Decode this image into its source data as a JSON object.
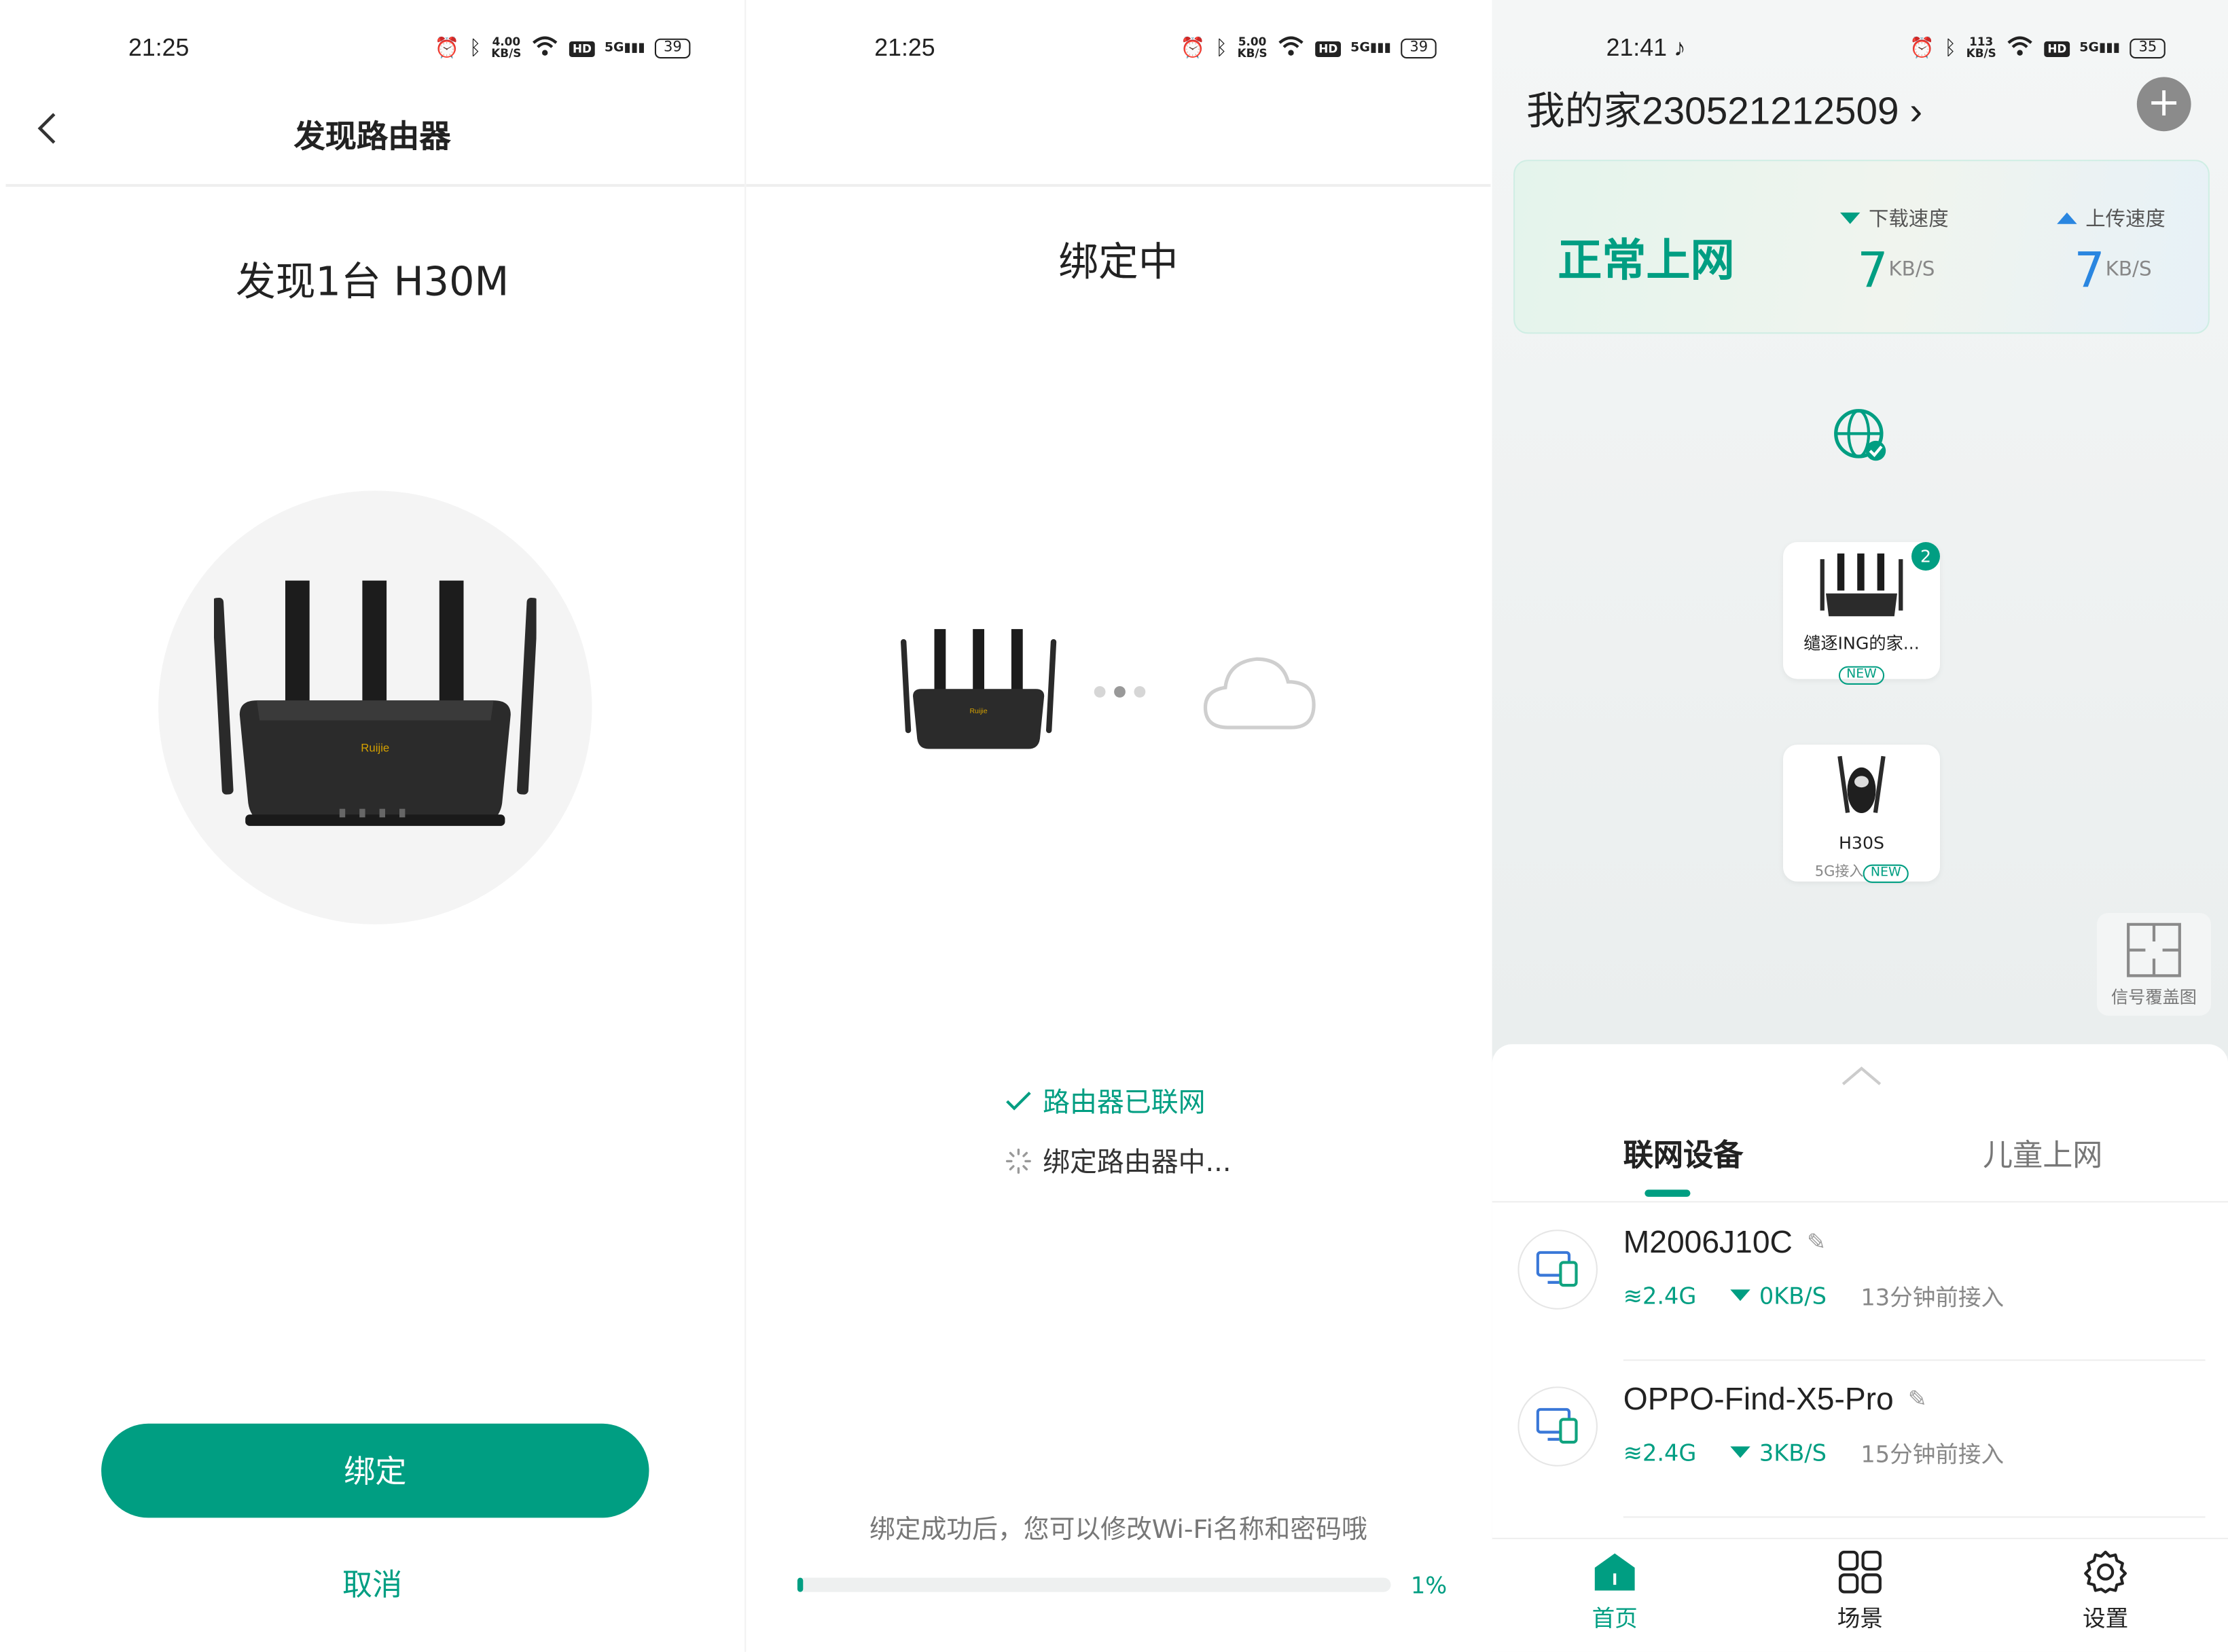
{
  "colors": {
    "brand": "#009e82",
    "upload": "#2a86e0"
  },
  "panel1": {
    "status": {
      "time": "21:25",
      "speed_num": "4.00",
      "speed_unit": "KB/S",
      "hd": "HD",
      "net": "5G",
      "battery": "39"
    },
    "title": "发现路由器",
    "found_text": "发现1台 H30M",
    "router_brand": "Ruijie",
    "bind_label": "绑定",
    "cancel_label": "取消"
  },
  "panel2": {
    "status": {
      "time": "21:25",
      "speed_num": "5.00",
      "speed_unit": "KB/S",
      "hd": "HD",
      "net": "5G",
      "battery": "39"
    },
    "title": "绑定中",
    "router_brand": "Ruijie",
    "step_connected": "路由器已联网",
    "step_binding": "绑定路由器中...",
    "hint": "绑定成功后，您可以修改Wi-Fi名称和密码哦",
    "progress_label": "1%",
    "progress_value": 0.01
  },
  "panel3": {
    "status": {
      "time": "21:41",
      "speed_num": "113",
      "speed_unit": "KB/S",
      "hd": "HD",
      "net": "5G",
      "battery": "35"
    },
    "home_title": "我的家230521212509",
    "net_status": "正常上网",
    "download": {
      "label": "下载速度",
      "value": "7",
      "unit": "KB/S"
    },
    "upload": {
      "label": "上传速度",
      "value": "7",
      "unit": "KB/S"
    },
    "main_node": {
      "name": "缱逐ING的家...",
      "badge": "NEW",
      "count": "2"
    },
    "sub_node": {
      "name": "H30S",
      "sub": "5G接入",
      "badge": "NEW"
    },
    "coverage_label": "信号覆盖图",
    "tabs": {
      "devices": "联网设备",
      "kids": "儿童上网"
    },
    "devices": [
      {
        "name": "M2006J10C",
        "band": "2.4G",
        "speed": "0KB/S",
        "time": "13分钟前接入"
      },
      {
        "name": "OPPO-Find-X5-Pro",
        "band": "2.4G",
        "speed": "3KB/S",
        "time": "15分钟前接入"
      }
    ],
    "nav": {
      "home": "首页",
      "scene": "场景",
      "settings": "设置"
    }
  }
}
